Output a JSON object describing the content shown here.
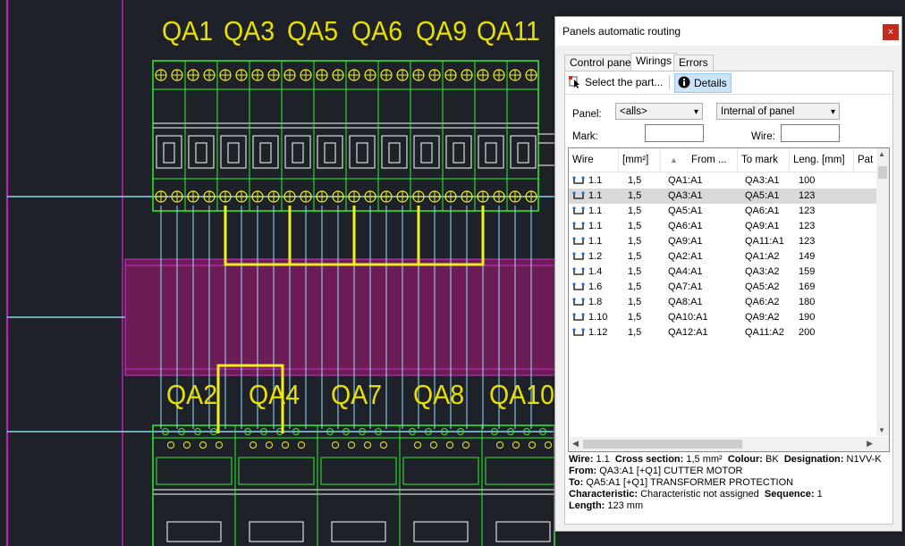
{
  "cad": {
    "top_labels": [
      "QA1",
      "QA3",
      "QA5",
      "QA6",
      "QA9",
      "QA11"
    ],
    "bottom_labels": [
      "QA2",
      "QA4",
      "QA7",
      "QA8",
      "QA10"
    ]
  },
  "dialog": {
    "title": "Panels automatic routing",
    "close_glyph": "×",
    "tabs": [
      "Control panel",
      "Wirings",
      "Errors"
    ],
    "active_tab": "Wirings",
    "toolbar": {
      "select_label": "Select the part...",
      "details_label": "Details"
    },
    "filters": {
      "panel_label": "Panel:",
      "panel_value": "<alls>",
      "scope_value": "Internal of panel",
      "mark_label": "Mark:",
      "mark_value": "",
      "wire_label": "Wire:",
      "wire_value": ""
    },
    "columns": [
      "Wire",
      "[mm²]",
      "From ...",
      "To mark",
      "Leng. [mm]",
      "Pat"
    ],
    "rows": [
      {
        "wire": "1.1",
        "section": "1,5",
        "from": "QA1:A1",
        "to": "QA3:A1",
        "length": "100"
      },
      {
        "wire": "1.1",
        "section": "1,5",
        "from": "QA3:A1",
        "to": "QA5:A1",
        "length": "123",
        "selected": true
      },
      {
        "wire": "1.1",
        "section": "1,5",
        "from": "QA5:A1",
        "to": "QA6:A1",
        "length": "123"
      },
      {
        "wire": "1.1",
        "section": "1,5",
        "from": "QA6:A1",
        "to": "QA9:A1",
        "length": "123"
      },
      {
        "wire": "1.1",
        "section": "1,5",
        "from": "QA9:A1",
        "to": "QA11:A1",
        "length": "123"
      },
      {
        "wire": "1.2",
        "section": "1,5",
        "from": "QA2:A1",
        "to": "QA1:A2",
        "length": "149"
      },
      {
        "wire": "1.4",
        "section": "1,5",
        "from": "QA4:A1",
        "to": "QA3:A2",
        "length": "159"
      },
      {
        "wire": "1.6",
        "section": "1,5",
        "from": "QA7:A1",
        "to": "QA5:A2",
        "length": "169"
      },
      {
        "wire": "1.8",
        "section": "1,5",
        "from": "QA8:A1",
        "to": "QA6:A2",
        "length": "180"
      },
      {
        "wire": "1.10",
        "section": "1,5",
        "from": "QA10:A1",
        "to": "QA9:A2",
        "length": "190"
      },
      {
        "wire": "1.12",
        "section": "1,5",
        "from": "QA12:A1",
        "to": "QA11:A2",
        "length": "200"
      }
    ],
    "details": {
      "wire_label": "Wire:",
      "wire_value": "1.1",
      "cross_label": "Cross section:",
      "cross_value": "1,5 mm²",
      "colour_label": "Colour:",
      "colour_value": "BK",
      "designation_label": "Designation:",
      "designation_value": "N1VV-K",
      "from_label": "From:",
      "from_value": "QA3:A1  [+Q1] CUTTER MOTOR",
      "to_label": "To:",
      "to_value": "QA5:A1  [+Q1] TRANSFORMER PROTECTION",
      "characteristic_label": "Characteristic:",
      "characteristic_value": "Characteristic not assigned",
      "sequence_label": "Sequence:",
      "sequence_value": "1",
      "length_label": "Length:",
      "length_value": "123 mm"
    }
  },
  "colors": {
    "cad_background": "#1e2228",
    "component_green": "#2ef02e",
    "wire_cyan": "#8ad4f0",
    "wire_yellow": "#f0f020",
    "duct_magenta": "#7a1e5a",
    "label_yellow": "#e8e000",
    "selection": "#d9d9d9"
  }
}
